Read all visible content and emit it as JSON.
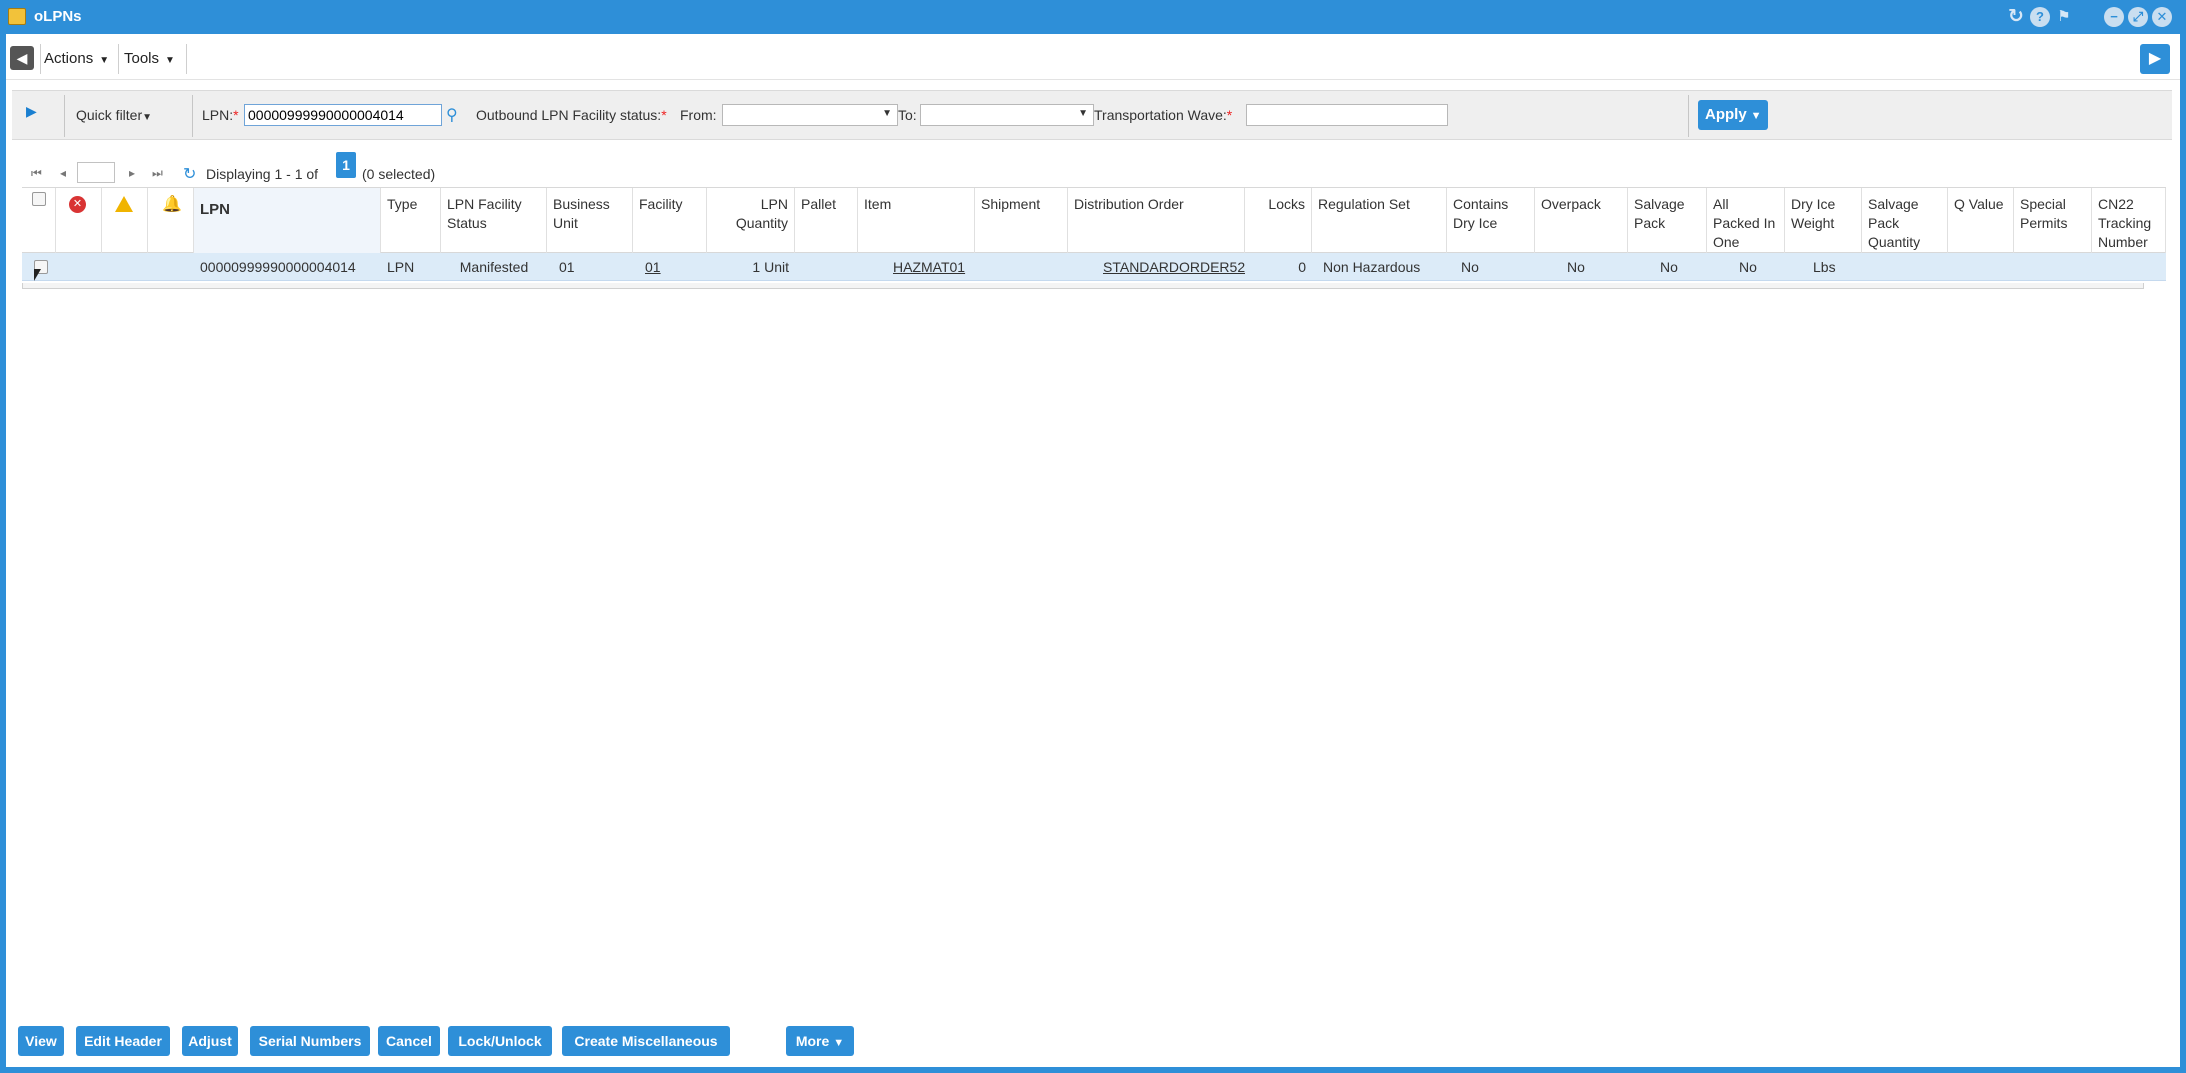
{
  "window": {
    "title": "oLPNs"
  },
  "menubar": {
    "actions_label": "Actions",
    "tools_label": "Tools"
  },
  "filter": {
    "quick_filter_label": "Quick filter",
    "lpn_label": "LPN:",
    "lpn_value": "00000999990000004014",
    "status_label": "Outbound LPN Facility status:",
    "from_label": "From:",
    "from_value": "",
    "to_label": "To:",
    "to_value": "",
    "wave_label": "Transportation Wave:",
    "wave_value": "",
    "required_mark": "*",
    "apply_label": "Apply"
  },
  "pager": {
    "displaying_text": "Displaying 1 - 1 of",
    "page_number": "1",
    "selected_text": "(0 selected)",
    "page_input_value": ""
  },
  "grid": {
    "columns": [
      "LPN",
      "Type",
      "LPN Facility Status",
      "Business Unit",
      "Facility",
      "LPN Quantity",
      "Pallet",
      "Item",
      "Shipment",
      "Distribution Order",
      "Locks",
      "Regulation Set",
      "Contains Dry Ice",
      "Overpack",
      "Salvage Pack",
      "All Packed In One",
      "Dry Ice Weight",
      "Salvage Pack Quantity",
      "Q Value",
      "Special Permits",
      "CN22 Tracking Number"
    ],
    "rows": [
      {
        "lpn": "00000999990000004014",
        "type": "LPN",
        "status": "Manifested",
        "business_unit": "01",
        "facility": "01",
        "quantity": "1 Unit",
        "pallet": "",
        "item": "HAZMAT01",
        "shipment": "",
        "distribution_order": "STANDARDORDER52",
        "locks": "0",
        "regulation_set": "Non Hazardous",
        "contains_dry_ice": "No",
        "overpack": "No",
        "salvage_pack": "No",
        "all_packed_in_one": "No",
        "dry_ice_weight": "Lbs",
        "salvage_pack_quantity": "",
        "q_value": "",
        "special_permits": "",
        "cn22": ""
      }
    ]
  },
  "buttons": {
    "view": "View",
    "edit_header": "Edit Header",
    "adjust": "Adjust",
    "serial_numbers": "Serial Numbers",
    "cancel": "Cancel",
    "lock_unlock": "Lock/Unlock",
    "create_misc": "Create Miscellaneous",
    "more": "More"
  },
  "icons": {
    "app": "folder-icon",
    "refresh": "refresh-icon",
    "help": "help-icon",
    "pin": "pin-icon",
    "minimize": "minimize-icon",
    "maximize": "maximize-icon",
    "close": "close-icon"
  },
  "colors": {
    "accent": "#2e8fd8",
    "selected_row": "#dcebf8",
    "required": "#ee2222"
  }
}
